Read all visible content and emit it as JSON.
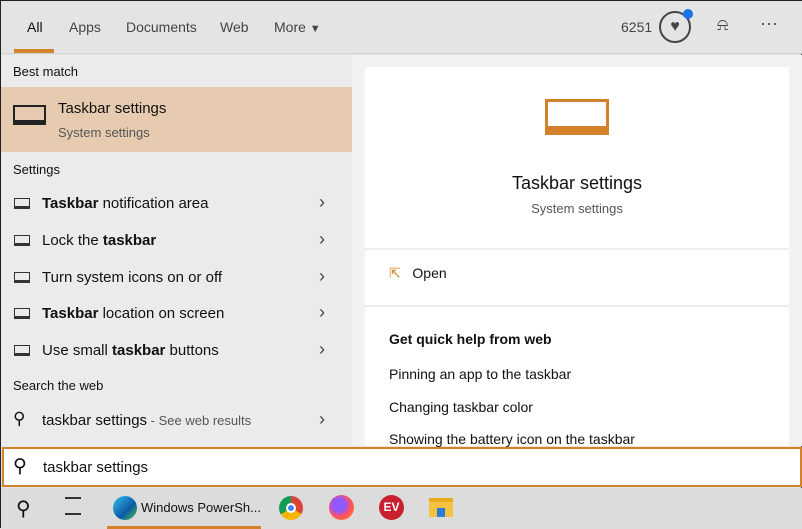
{
  "tabs": [
    "All",
    "Apps",
    "Documents",
    "Web",
    "More"
  ],
  "header": {
    "points": "6251"
  },
  "left": {
    "best_match_heading": "Best match",
    "best": {
      "title": "Taskbar settings",
      "subtitle": "System settings"
    },
    "settings_heading": "Settings",
    "settings": [
      {
        "bold": "Taskbar",
        "rest": " notification area",
        "pre": ""
      },
      {
        "pre": "Lock the ",
        "bold": "taskbar",
        "rest": ""
      },
      {
        "pre": "Turn system icons on or off",
        "bold": "",
        "rest": ""
      },
      {
        "bold": "Taskbar",
        "rest": " location on screen",
        "pre": ""
      },
      {
        "pre": "Use small ",
        "bold": "taskbar",
        "rest": " buttons"
      }
    ],
    "web_heading": "Search the web",
    "web": {
      "query": "taskbar settings",
      "hint": " - See web results"
    }
  },
  "right": {
    "title": "Taskbar settings",
    "subtitle": "System settings",
    "open": "Open",
    "help_heading": "Get quick help from web",
    "links": [
      "Pinning an app to the taskbar",
      "Changing taskbar color",
      "Showing the battery icon on the taskbar"
    ]
  },
  "search": {
    "value": "taskbar settings"
  },
  "taskbar": {
    "app": "Windows PowerSh..."
  },
  "colors": {
    "accent": "#d3822a",
    "highlight": "#e6cbb0"
  }
}
